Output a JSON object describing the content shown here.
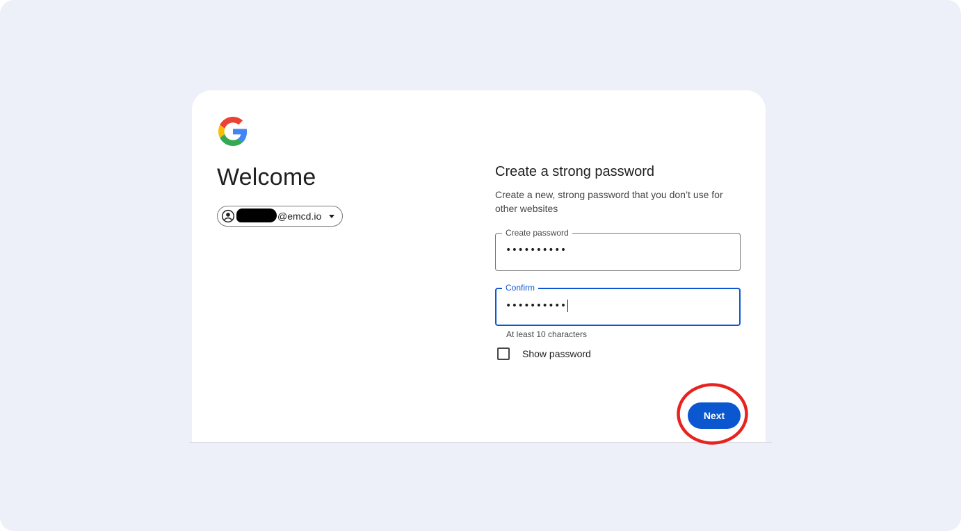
{
  "welcome": {
    "title": "Welcome",
    "account_email_suffix": "@emcd.io"
  },
  "form": {
    "heading": "Create a strong password",
    "subtext": "Create a new, strong password that you don’t use for other websites",
    "create_field": {
      "label": "Create password",
      "value": "••••••••••"
    },
    "confirm_field": {
      "label": "Confirm",
      "value": "••••••••••",
      "focused": true
    },
    "hint": "At least 10 characters",
    "show_password": {
      "label": "Show password",
      "checked": false
    },
    "next_label": "Next"
  },
  "annotation": {
    "highlight_color": "#e8231f",
    "target": "next-button"
  },
  "colors": {
    "page_bg": "#edf0f9",
    "card_bg": "#ffffff",
    "primary": "#0b57d0",
    "text": "#1f1f1f",
    "muted_text": "#444746"
  },
  "icons": {
    "logo": "google-logo",
    "avatar": "account-circle-icon",
    "chip_dropdown": "caret-down-icon"
  }
}
